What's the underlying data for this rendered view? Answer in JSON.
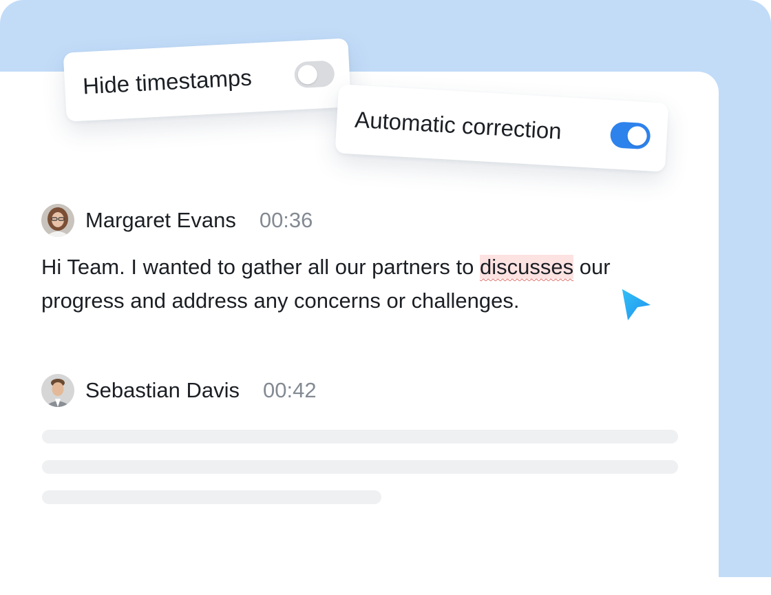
{
  "settings": {
    "hide_timestamps": {
      "label": "Hide timestamps",
      "enabled": false
    },
    "automatic_correction": {
      "label": "Automatic correction",
      "enabled": true
    }
  },
  "transcript": {
    "entries": [
      {
        "speaker": "Margaret Evans",
        "time": "00:36",
        "text_before": "Hi Team. I wanted to gather all our partners to ",
        "flagged_word": "discusses",
        "text_after": " our progress and address any concerns or challenges."
      },
      {
        "speaker": "Sebastian Davis",
        "time": "00:42"
      }
    ]
  },
  "colors": {
    "backdrop": "#c2dcf8",
    "toggle_on": "#2e82ec",
    "toggle_off": "#d9dbdf",
    "flag_highlight": "#fde2e2",
    "flag_underline": "#e0706c",
    "cursor": "#1aa3ef"
  },
  "icons": {
    "cursor": "pointer-arrow-icon",
    "avatar_1": "user-avatar",
    "avatar_2": "user-avatar"
  }
}
